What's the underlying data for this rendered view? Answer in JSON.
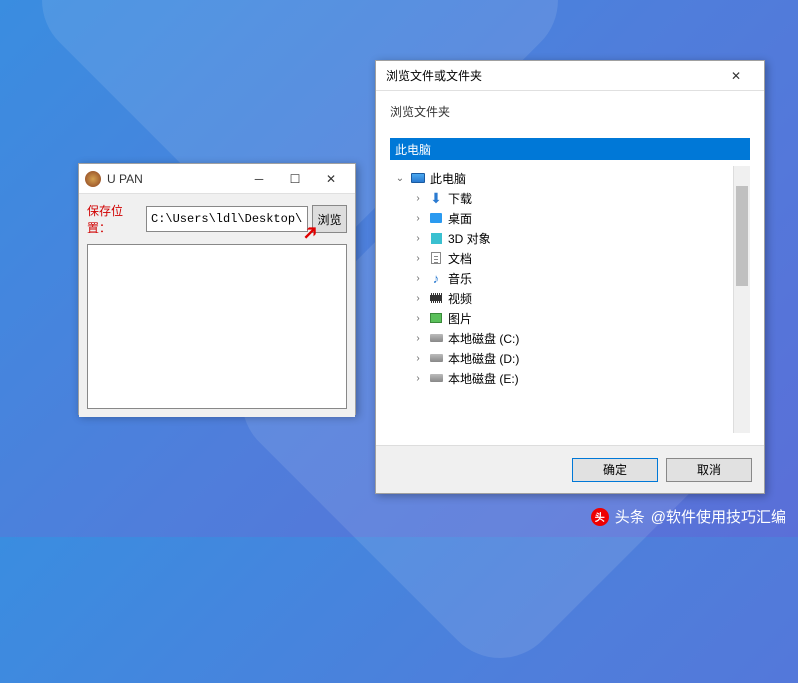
{
  "upan": {
    "title": "U PAN",
    "save_label": "保存位置：",
    "path_value": "C:\\Users\\ldl\\Desktop\\",
    "browse_label": "浏览"
  },
  "dialog": {
    "title": "浏览文件或文件夹",
    "subtitle": "浏览文件夹",
    "selected_path": "此电脑",
    "ok_label": "确定",
    "cancel_label": "取消",
    "tree": {
      "root": "此电脑",
      "items": [
        {
          "label": "下载",
          "icon": "download"
        },
        {
          "label": "桌面",
          "icon": "desktop"
        },
        {
          "label": "3D 对象",
          "icon": "3d"
        },
        {
          "label": "文档",
          "icon": "doc"
        },
        {
          "label": "音乐",
          "icon": "music"
        },
        {
          "label": "视频",
          "icon": "video"
        },
        {
          "label": "图片",
          "icon": "pic"
        },
        {
          "label": "本地磁盘 (C:)",
          "icon": "disk"
        },
        {
          "label": "本地磁盘 (D:)",
          "icon": "disk"
        },
        {
          "label": "本地磁盘 (E:)",
          "icon": "disk"
        }
      ]
    }
  },
  "watermark": {
    "brand": "头条",
    "author": "@软件使用技巧汇编"
  }
}
